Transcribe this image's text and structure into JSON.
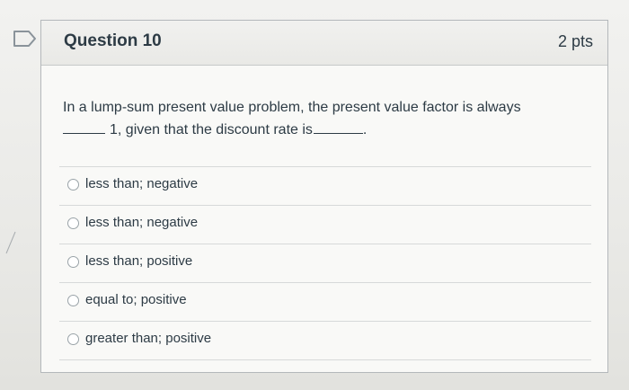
{
  "question": {
    "title": "Question 10",
    "points": "2 pts",
    "text_part1": "In a lump-sum present value problem, the present value factor is always",
    "text_part2": "1, given that the discount rate is",
    "text_part3": "."
  },
  "answers": [
    {
      "label": "less than; negative",
      "selected": false
    },
    {
      "label": "less than; negative",
      "selected": false
    },
    {
      "label": "less than; positive",
      "selected": false
    },
    {
      "label": "equal to; positive",
      "selected": false
    },
    {
      "label": "greater than; positive",
      "selected": false
    }
  ],
  "icons": {
    "flag": "flag-bookmark-icon"
  },
  "colors": {
    "text": "#2d3b45",
    "border": "#b4b8bb"
  }
}
